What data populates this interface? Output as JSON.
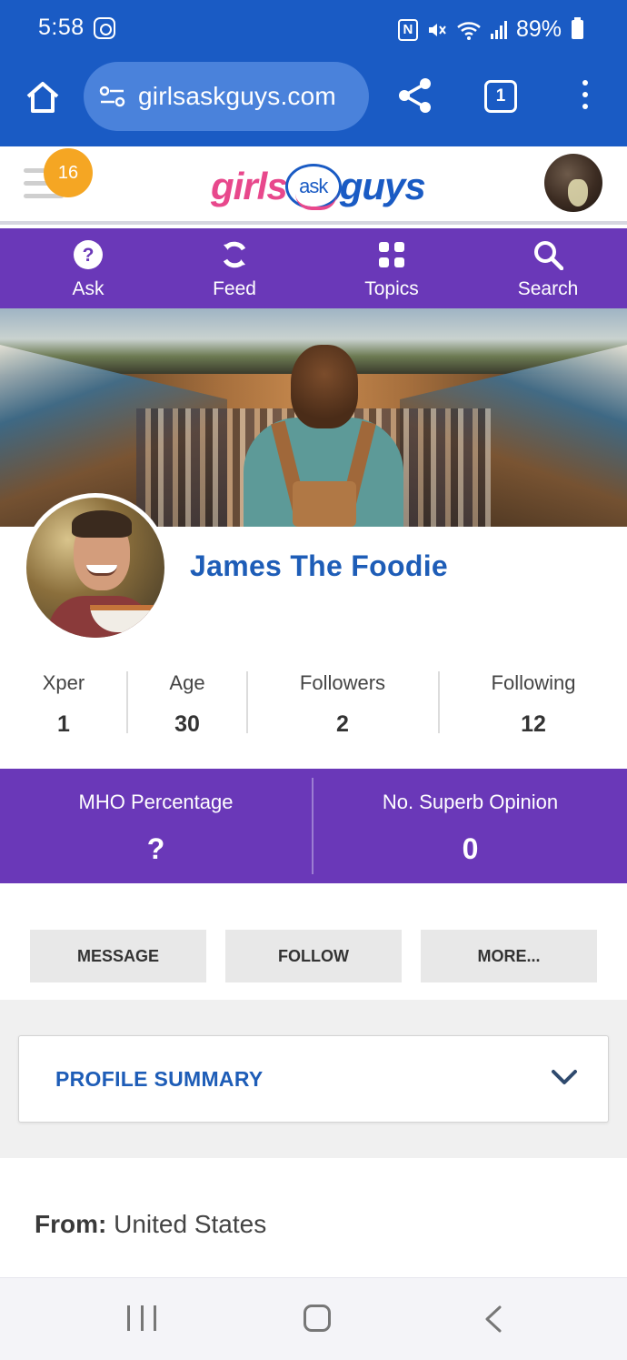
{
  "status_bar": {
    "time": "5:58",
    "nfc_glyph": "N",
    "battery": "89%",
    "icons": [
      "instagram-icon",
      "nfc-icon",
      "mute-icon",
      "wifi-icon",
      "signal-icon",
      "battery-icon"
    ]
  },
  "browser": {
    "url": "girlsaskguys.com",
    "tab_count": "1"
  },
  "site_header": {
    "notification_count": "16",
    "logo": {
      "part1": "girls",
      "part2": "ask",
      "part3": "guys"
    }
  },
  "nav": {
    "items": [
      {
        "label": "Ask",
        "icon": "question-icon"
      },
      {
        "label": "Feed",
        "icon": "feed-icon"
      },
      {
        "label": "Topics",
        "icon": "grid-icon"
      },
      {
        "label": "Search",
        "icon": "search-icon"
      }
    ]
  },
  "profile": {
    "name": "James The Foodie",
    "stats": [
      {
        "label": "Xper",
        "value": "1"
      },
      {
        "label": "Age",
        "value": "30"
      },
      {
        "label": "Followers",
        "value": "2"
      },
      {
        "label": "Following",
        "value": "12"
      }
    ],
    "metrics": [
      {
        "label": "MHO Percentage",
        "value": "?"
      },
      {
        "label": "No. Superb Opinion",
        "value": "0"
      }
    ],
    "actions": {
      "message": "MESSAGE",
      "follow": "FOLLOW",
      "more": "MORE..."
    },
    "summary_title": "PROFILE SUMMARY",
    "from_label": "From:",
    "from_value": "United States"
  },
  "colors": {
    "browser_blue": "#1a5bc4",
    "brand_purple": "#6a38b8",
    "name_blue": "#1e5db7",
    "badge_orange": "#f5a623",
    "logo_pink": "#e8488c"
  }
}
